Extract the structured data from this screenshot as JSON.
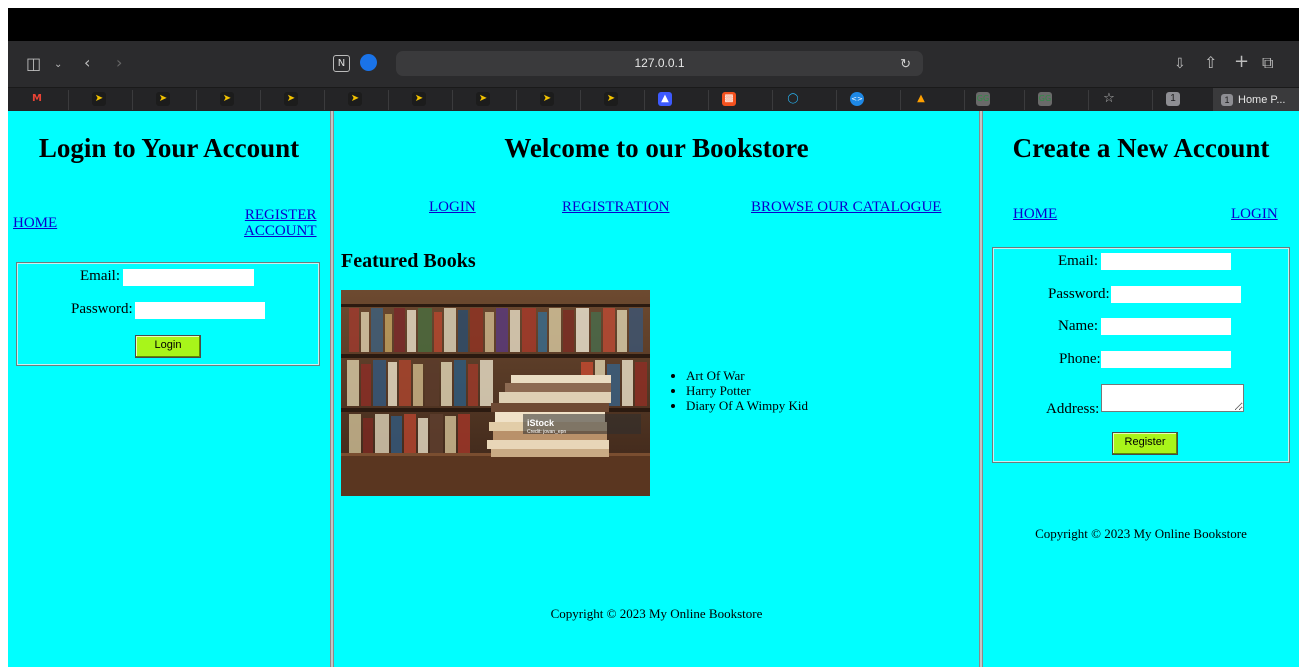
{
  "browser": {
    "url": "127.0.0.1",
    "tab_title": "Home P...",
    "tab_badge": "1",
    "favorites_badge": "1"
  },
  "left_frame": {
    "title": "Login to Your Account",
    "nav": {
      "home": "HOME",
      "register_line1": "REGISTER",
      "register_line2": "ACCOUNT"
    },
    "form": {
      "email_label": "Email:",
      "email_value": "",
      "password_label": "Password:",
      "password_value": "",
      "login_button": "Login"
    }
  },
  "middle_frame": {
    "title": "Welcome to our Bookstore",
    "nav": {
      "login": "LOGIN",
      "registration": "REGISTRATION",
      "catalogue": "BROWSE OUR CATALOGUE"
    },
    "featured_heading": "Featured Books",
    "image_watermark": "iStock",
    "image_credit": "Credit: jovan_epn",
    "books": [
      "Art Of War",
      "Harry Potter",
      "Diary Of A Wimpy Kid"
    ],
    "copyright": "Copyright © 2023 My Online Bookstore"
  },
  "right_frame": {
    "title": "Create a New Account",
    "nav": {
      "home": "HOME",
      "login": "LOGIN"
    },
    "form": {
      "email_label": "Email:",
      "password_label": "Password:",
      "name_label": "Name:",
      "phone_label": "Phone:",
      "address_label": "Address:",
      "register_button": "Register"
    },
    "copyright": "Copyright © 2023 My Online Bookstore"
  },
  "colors": {
    "frame_bg": "#00ffff",
    "link": "#0b00cc",
    "button": "#a8f51a"
  }
}
